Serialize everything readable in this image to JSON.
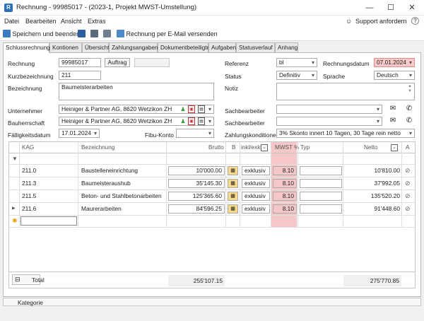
{
  "window": {
    "title": "Rechnung - 99985017 - (2023-1, Projekt MWST-Umstellung)",
    "minimize": "—",
    "maximize": "☐",
    "close": "✕"
  },
  "menu": [
    "Datei",
    "Bearbeiten",
    "Ansicht",
    "Extras"
  ],
  "support": {
    "label": "Support anfordern",
    "help": "?"
  },
  "toolbar": {
    "save_close": "Speichern und beenden",
    "email": "Rechnung per E-Mail versenden"
  },
  "tabs": [
    "Schlussrechnung",
    "Kontionen",
    "Übersicht",
    "Zahlungsangaben",
    "Dokumentbeteiligte",
    "Aufgaben",
    "Statusverlauf",
    "Anhang"
  ],
  "form": {
    "rechnung_label": "Rechnung",
    "rechnung_value": "99985017",
    "auftrag_button": "Auftrag",
    "kurz_label": "Kurzbezeichnung",
    "kurz_value": "211",
    "bezeichnung_label": "Bezeichnung",
    "bezeichnung_value": "Baumeisterarbeiten",
    "unternehmer_label": "Unternehmer",
    "unternehmer_value": "Heiniger & Partner AG, 8620 Wetzikon ZH",
    "bauherr_label": "Bauherrschaft",
    "bauherr_value": "Heiniger & Partner AG, 8620 Wetzikon ZH",
    "faellig_label": "Fälligkeitsdatum",
    "faellig_value": "17.01.2024",
    "fibu_label": "Fibu-Konto",
    "fibu_value": "",
    "referenz_label": "Referenz",
    "referenz_value": "bl",
    "rdatum_label": "Rechnungsdatum",
    "rdatum_value": "07.01.2024",
    "status_label": "Status",
    "status_value": "Definitiv",
    "sprache_label": "Sprache",
    "sprache_value": "Deutsch",
    "notiz_label": "Notiz",
    "notiz_value": "",
    "sach1_label": "Sachbearbeiter",
    "sach2_label": "Sachbearbeiter",
    "zahlung_label": "Zahlungskonditionen",
    "zahlung_value": "3% Skonto innert 10 Tagen, 30 Tage rein netto"
  },
  "grid": {
    "headers": {
      "kag": "KAG",
      "bez": "Bezeichnung",
      "brutto": "Brutto",
      "b": "B",
      "inkl": "inkl/exkl",
      "mwst": "MWST %",
      "typ": "Typ",
      "netto": "Netto",
      "a": "A"
    },
    "rows": [
      {
        "kag": "211.0",
        "bez": "Baustelleneinrichtung",
        "brutto": "10'000.00",
        "inkl": "exklusiv",
        "mwst": "8.10",
        "netto": "10'810.00"
      },
      {
        "kag": "211.3",
        "bez": "Baumeisteraushub",
        "brutto": "35'145.30",
        "inkl": "exklusiv",
        "mwst": "8.10",
        "netto": "37'992.05"
      },
      {
        "kag": "211.5",
        "bez": "Beton- und Stahlbetonarbeiten",
        "brutto": "125'365.60",
        "inkl": "exklusiv",
        "mwst": "8.10",
        "netto": "135'520.20"
      },
      {
        "kag": "211.6",
        "bez": "Maurerarbeiten",
        "brutto": "84'596.25",
        "inkl": "exklusiv",
        "mwst": "8.10",
        "netto": "91'448.60"
      }
    ],
    "total_label": "Total",
    "total_brutto": "255'107.15",
    "total_netto": "275'770.85"
  },
  "footer": {
    "kategorie": "Kategorie"
  },
  "colors": {
    "accent": "#2a6fb8",
    "highlight": "#f6c7c9",
    "green": "#3a9a3a"
  }
}
